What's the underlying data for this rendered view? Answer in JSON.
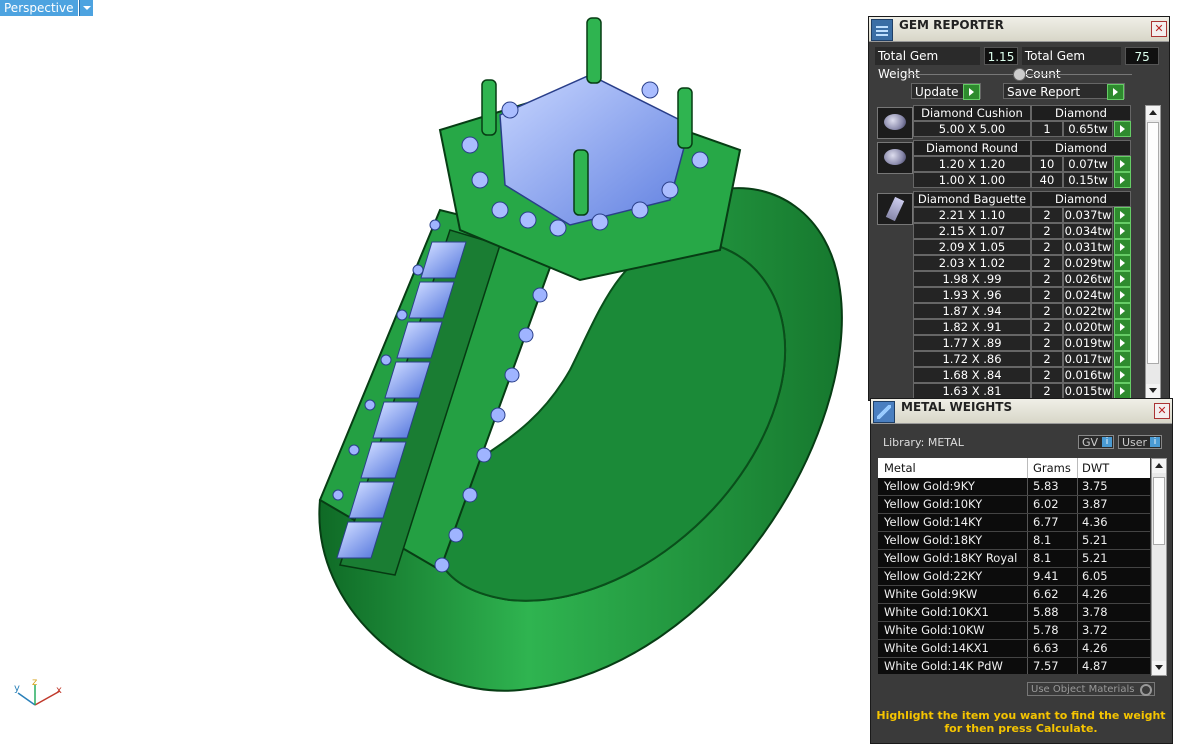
{
  "viewport": {
    "label": "Perspective",
    "axis": {
      "x": "x",
      "y": "y",
      "z": "z"
    }
  },
  "colors": {
    "ring": "#2aa04a",
    "stones": "#8fb0ff",
    "accent_green": "#2e8b2e",
    "hint": "#f5c400"
  },
  "gem_reporter": {
    "title": "GEM REPORTER",
    "total_weight_label": "Total Gem Weight",
    "total_weight": "1.15",
    "total_count_label": "Total Gem Count",
    "total_count": "75",
    "update_label": "Update",
    "save_label": "Save Report",
    "groups": [
      {
        "name": "Diamond Cushion",
        "type": "Diamond",
        "icon": "cushion-gem-icon",
        "rows": [
          {
            "size": "5.00 X 5.00",
            "qty": "1",
            "wt": "0.65tw"
          }
        ]
      },
      {
        "name": "Diamond Round",
        "type": "Diamond",
        "icon": "round-gem-icon",
        "rows": [
          {
            "size": "1.20 X 1.20",
            "qty": "10",
            "wt": "0.07tw"
          },
          {
            "size": "1.00 X 1.00",
            "qty": "40",
            "wt": "0.15tw"
          }
        ]
      },
      {
        "name": "Diamond Baguette",
        "type": "Diamond",
        "icon": "baguette-gem-icon",
        "rows": [
          {
            "size": "2.21 X 1.10",
            "qty": "2",
            "wt": "0.037tw"
          },
          {
            "size": "2.15 X 1.07",
            "qty": "2",
            "wt": "0.034tw"
          },
          {
            "size": "2.09 X 1.05",
            "qty": "2",
            "wt": "0.031tw"
          },
          {
            "size": "2.03 X 1.02",
            "qty": "2",
            "wt": "0.029tw"
          },
          {
            "size": "1.98 X .99",
            "qty": "2",
            "wt": "0.026tw"
          },
          {
            "size": "1.93 X .96",
            "qty": "2",
            "wt": "0.024tw"
          },
          {
            "size": "1.87 X .94",
            "qty": "2",
            "wt": "0.022tw"
          },
          {
            "size": "1.82 X .91",
            "qty": "2",
            "wt": "0.020tw"
          },
          {
            "size": "1.77 X .89",
            "qty": "2",
            "wt": "0.019tw"
          },
          {
            "size": "1.72 X .86",
            "qty": "2",
            "wt": "0.017tw"
          },
          {
            "size": "1.68 X .84",
            "qty": "2",
            "wt": "0.016tw"
          },
          {
            "size": "1.63 X .81",
            "qty": "2",
            "wt": "0.015tw"
          }
        ]
      }
    ]
  },
  "metal_weights": {
    "title": "METAL WEIGHTS",
    "library_label": "Library: METAL",
    "gv_label": "GV",
    "user_label": "User",
    "columns": {
      "metal": "Metal",
      "grams": "Grams",
      "dwt": "DWT"
    },
    "rows": [
      {
        "metal": "Yellow Gold:9KY",
        "grams": "5.83",
        "dwt": "3.75"
      },
      {
        "metal": "Yellow Gold:10KY",
        "grams": "6.02",
        "dwt": "3.87"
      },
      {
        "metal": "Yellow Gold:14KY",
        "grams": "6.77",
        "dwt": "4.36"
      },
      {
        "metal": "Yellow Gold:18KY",
        "grams": "8.1",
        "dwt": "5.21"
      },
      {
        "metal": "Yellow Gold:18KY Royal",
        "grams": "8.1",
        "dwt": "5.21"
      },
      {
        "metal": "Yellow Gold:22KY",
        "grams": "9.41",
        "dwt": "6.05"
      },
      {
        "metal": "White Gold:9KW",
        "grams": "6.62",
        "dwt": "4.26"
      },
      {
        "metal": "White Gold:10KX1",
        "grams": "5.88",
        "dwt": "3.78"
      },
      {
        "metal": "White Gold:10KW",
        "grams": "5.78",
        "dwt": "3.72"
      },
      {
        "metal": "White Gold:14KX1",
        "grams": "6.63",
        "dwt": "4.26"
      },
      {
        "metal": "White Gold:14K PdW",
        "grams": "7.57",
        "dwt": "4.87"
      }
    ],
    "use_object_label": "Use Object Materials",
    "hint_line1": "Highlight the item you want to find the weight",
    "hint_line2": "for then press Calculate."
  }
}
